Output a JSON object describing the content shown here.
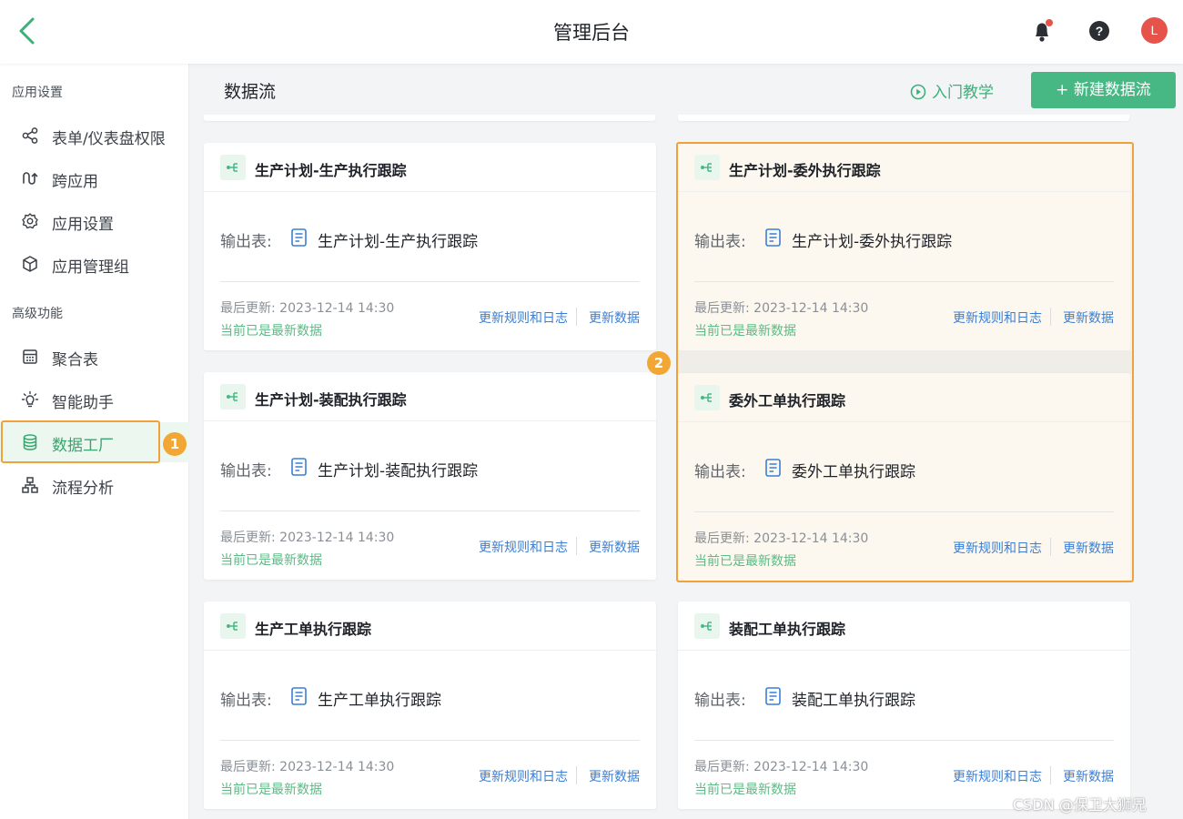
{
  "topbar": {
    "title": "管理后台",
    "avatar_letter": "L"
  },
  "sidebar": {
    "section_app": "应用设置",
    "section_advanced": "高级功能",
    "items": [
      {
        "label": "表单/仪表盘权限"
      },
      {
        "label": "跨应用"
      },
      {
        "label": "应用设置"
      },
      {
        "label": "应用管理组"
      },
      {
        "label": "聚合表"
      },
      {
        "label": "智能助手"
      },
      {
        "label": "数据工厂",
        "active": true
      },
      {
        "label": "流程分析"
      }
    ]
  },
  "annotations": {
    "badge_1": "1",
    "badge_2": "2"
  },
  "header": {
    "title": "数据流",
    "tutorial": "入门教学",
    "new_button": "+ 新建数据流"
  },
  "card_common": {
    "output_label": "输出表:",
    "updated_text": "最后更新: 2023-12-14 14:30",
    "status": "当前已是最新数据",
    "rules_link": "更新规则和日志",
    "update_link": "更新数据"
  },
  "cards": [
    {
      "title": "生产计划-生产执行跟踪",
      "output": "生产计划-生产执行跟踪"
    },
    {
      "title": "生产计划-委外执行跟踪",
      "output": "生产计划-委外执行跟踪"
    },
    {
      "title": "生产计划-装配执行跟踪",
      "output": "生产计划-装配执行跟踪"
    },
    {
      "title": "委外工单执行跟踪",
      "output": "委外工单执行跟踪"
    },
    {
      "title": "生产工单执行跟踪",
      "output": "生产工单执行跟踪"
    },
    {
      "title": "装配工单执行跟踪",
      "output": "装配工单执行跟踪"
    }
  ],
  "colors": {
    "accent": "#47b884",
    "link": "#3a7fd5",
    "highlight": "#f0a13a",
    "alert": "#e5534b"
  },
  "watermark": "CSDN @保卫大狮兄"
}
